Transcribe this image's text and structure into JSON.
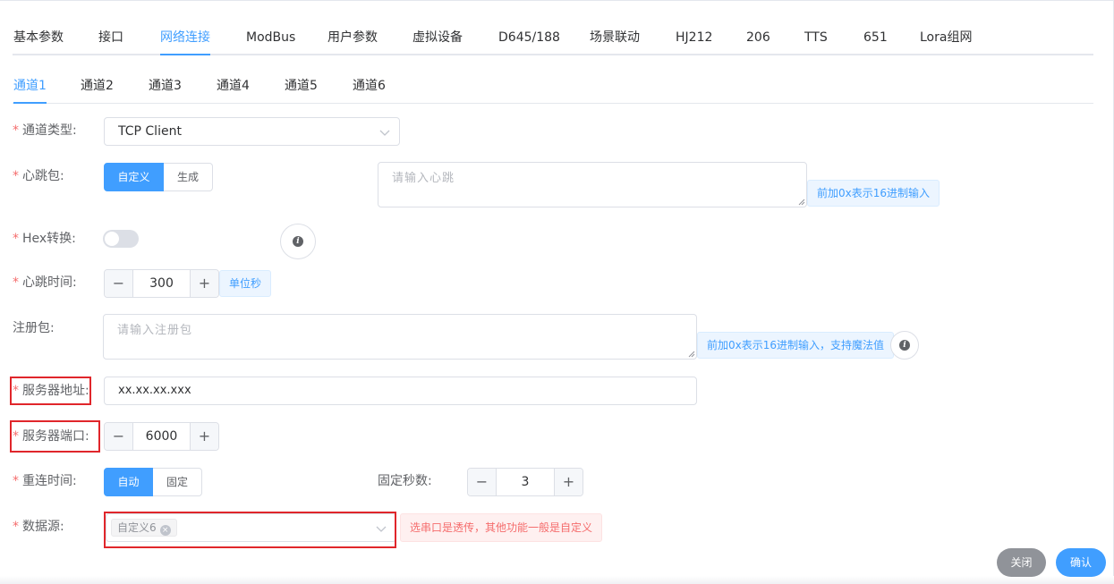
{
  "colors": {
    "accent": "#409eff",
    "danger": "#f56c6c",
    "highlight": "#e0262b",
    "close_button": "#909399"
  },
  "main_tabs": [
    "基本参数",
    "接口",
    "网络连接",
    "ModBus",
    "用户参数",
    "虚拟设备",
    "D645/188",
    "场景联动",
    "HJ212",
    "206",
    "TTS",
    "651",
    "Lora组网"
  ],
  "main_tab_active": "网络连接",
  "sub_tabs": [
    "通道1",
    "通道2",
    "通道3",
    "通道4",
    "通道5",
    "通道6"
  ],
  "sub_tab_active": "通道1",
  "required_mark": "*",
  "form": {
    "channel_type": {
      "label": "通道类型:",
      "value": "TCP Client"
    },
    "heartbeat": {
      "label": "心跳包:",
      "options": [
        "自定义",
        "生成"
      ],
      "selected": "自定义",
      "placeholder": "请输入心跳",
      "hint": "前加0x表示16进制输入"
    },
    "hex": {
      "label": "Hex转换:",
      "enabled": false,
      "info_icon": "info-icon"
    },
    "heartbeat_time": {
      "label": "心跳时间:",
      "value": "300",
      "unit": "单位秒"
    },
    "register": {
      "label": "注册包:",
      "placeholder": "请输入注册包",
      "hint": "前加0x表示16进制输入，支持魔法值",
      "info_icon": "info-icon"
    },
    "server_address": {
      "label": "服务器地址:",
      "value": "xx.xx.xx.xxx"
    },
    "server_port": {
      "label": "服务器端口:",
      "value": "6000"
    },
    "reconnect": {
      "label": "重连时间:",
      "options": [
        "自动",
        "固定"
      ],
      "selected": "自动"
    },
    "fixed_seconds": {
      "label": "固定秒数:",
      "value": "3"
    },
    "data_source": {
      "label": "数据源:",
      "tag": "自定义6",
      "hint": "选串口是透传，其他功能一般是自定义"
    }
  },
  "footer": {
    "close_label": "关闭",
    "confirm_label": "确认"
  }
}
